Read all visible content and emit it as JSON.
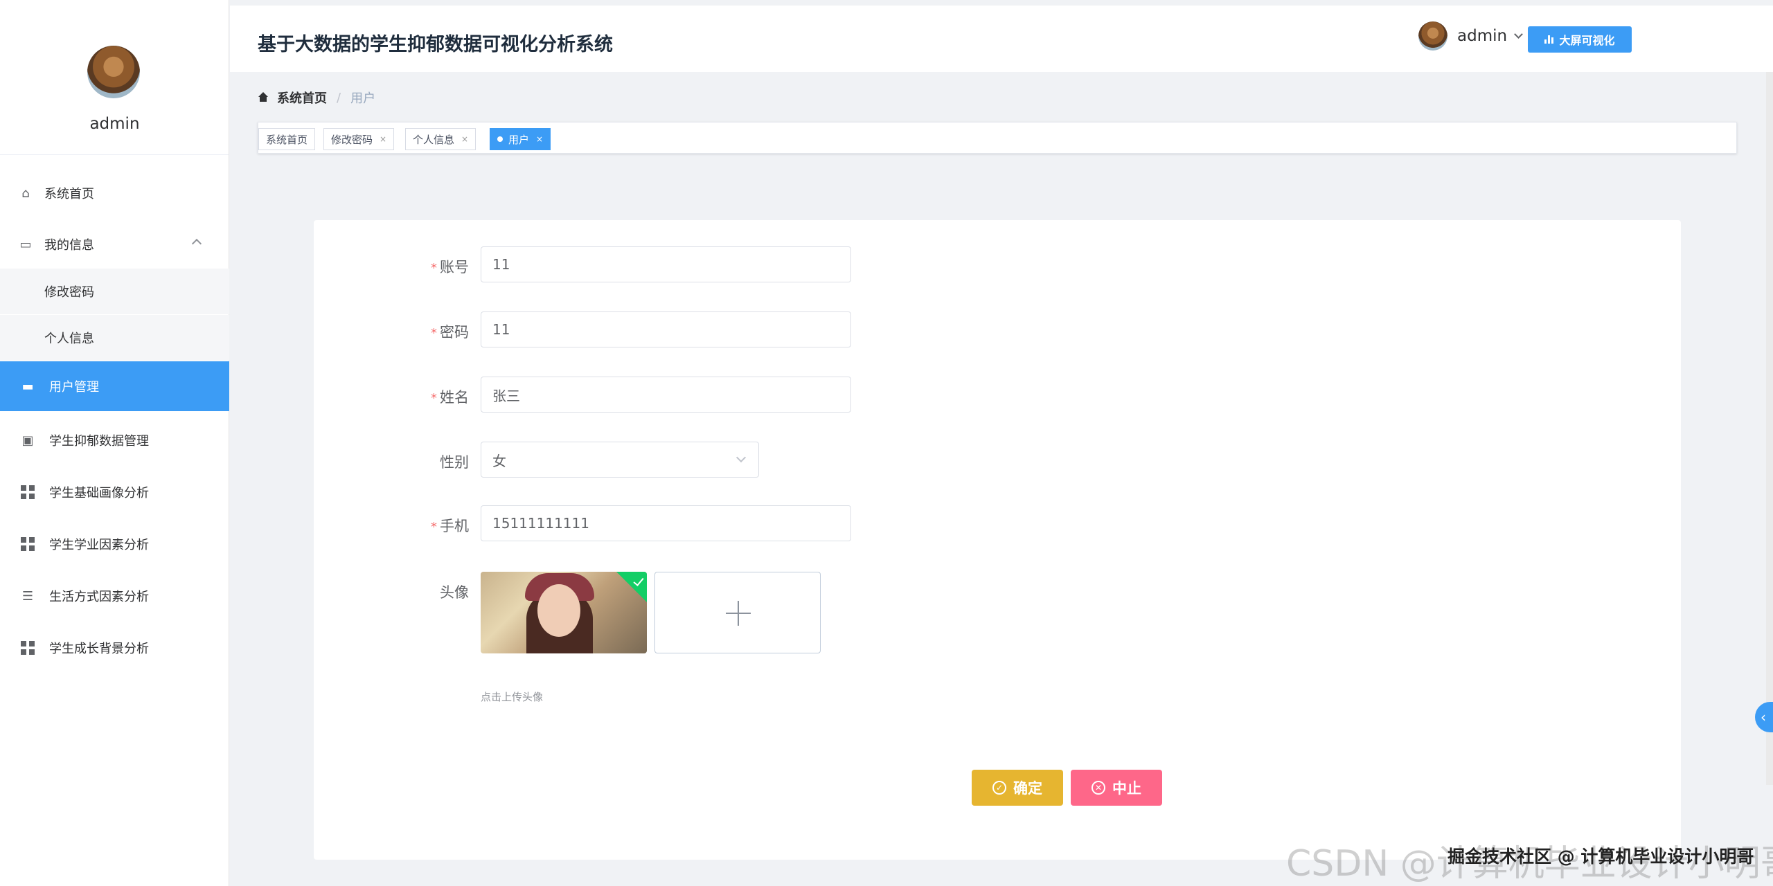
{
  "sidebar": {
    "username": "admin",
    "menu": {
      "home": "系统首页",
      "my_info": "我的信息",
      "change_password": "修改密码",
      "personal_info": "个人信息",
      "user_management": "用户管理",
      "depression_data": "学生抑郁数据管理",
      "basic_profile": "学生基础画像分析",
      "academic_factors": "学生学业因素分析",
      "lifestyle_factors": "生活方式因素分析",
      "growth_background": "学生成长背景分析"
    }
  },
  "header": {
    "title": "基于大数据的学生抑郁数据可视化分析系统",
    "bigscreen_label": "大屏可视化",
    "username": "admin"
  },
  "breadcrumb": {
    "home": "系统首页",
    "separator": "/",
    "current": "用户"
  },
  "tags": {
    "home": "系统首页",
    "change_password": "修改密码",
    "personal_info": "个人信息",
    "user": "用户",
    "close": "×"
  },
  "form": {
    "required_mark": "*",
    "account_label": "账号",
    "account_value": "11",
    "password_label": "密码",
    "password_value": "11",
    "name_label": "姓名",
    "name_value": "张三",
    "gender_label": "性别",
    "gender_value": "女",
    "phone_label": "手机",
    "phone_value": "15111111111",
    "avatar_label": "头像",
    "upload_tip": "点击上传头像",
    "confirm_label": "确定",
    "abort_label": "中止"
  },
  "watermark": {
    "csdn": "CSDN @计算机毕业设计小明哥",
    "juejin": "掘金技术社区 @ 计算机毕业设计小明哥"
  },
  "colors": {
    "primary": "#3c9cf5",
    "confirm": "#e6b530",
    "abort": "#fe6789",
    "required": "#f56c6c"
  }
}
